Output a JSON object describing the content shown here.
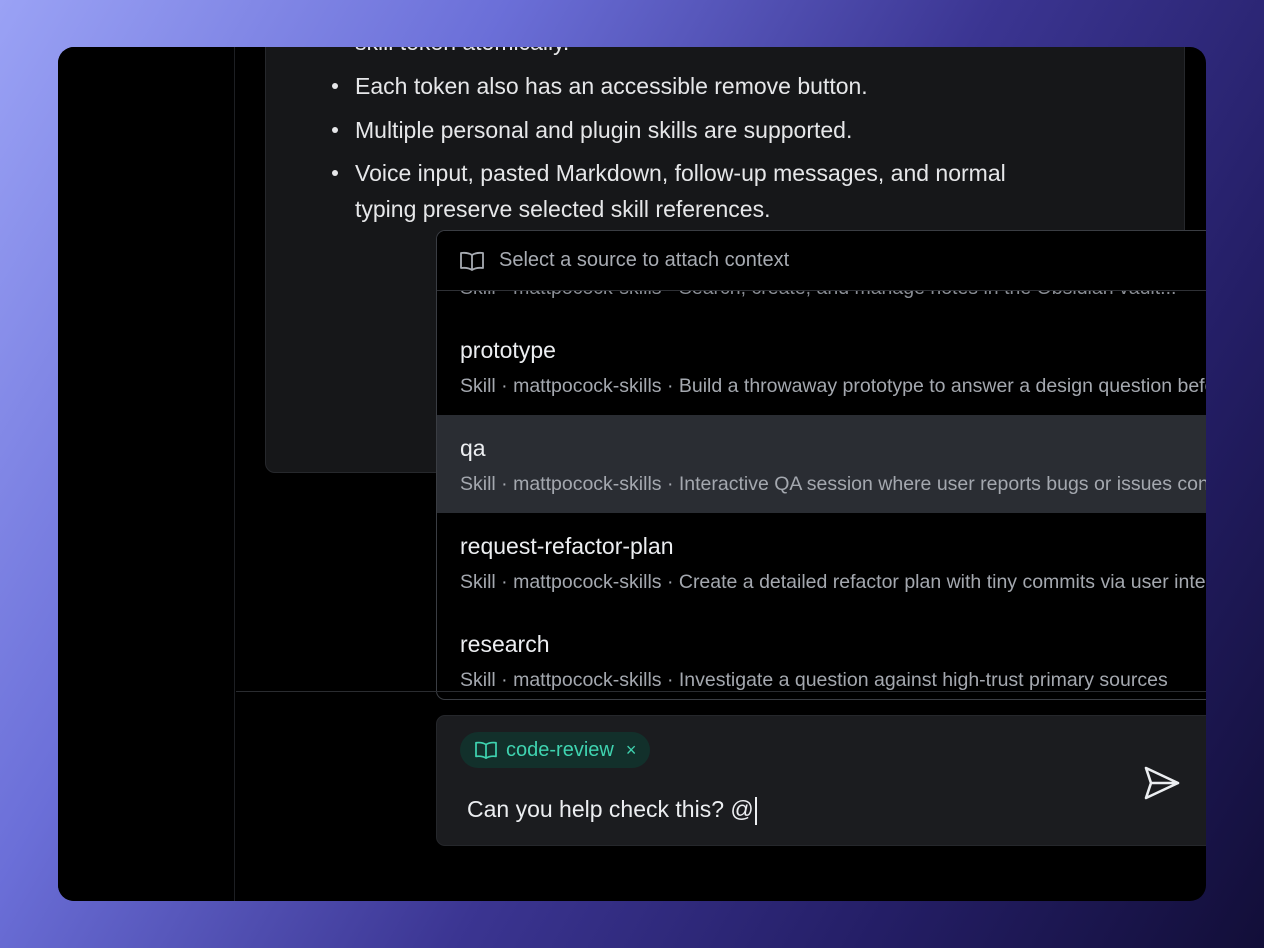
{
  "message": {
    "lines": [
      "skill token atomically.",
      "Each token also has an accessible remove button.",
      "Multiple personal and plugin skills are supported.",
      "Voice input, pasted Markdown, follow-up messages, and normal",
      "typing preserve selected skill references."
    ]
  },
  "popup": {
    "header": "Select a source to attach context",
    "header_icon": "book-open-icon",
    "cut_item_desc": "Skill · mattpocock-skills · Search, create, and manage notes in the Obsidian vault...",
    "items": [
      {
        "name": "prototype",
        "desc": "Skill · mattpocock-skills · Build a throwaway prototype to answer a design question before committing to an implementation"
      },
      {
        "name": "qa",
        "desc": "Skill · mattpocock-skills · Interactive QA session where user reports bugs or issues conversationally"
      },
      {
        "name": "request-refactor-plan",
        "desc": "Skill · mattpocock-skills · Create a detailed refactor plan with tiny commits via user interview"
      },
      {
        "name": "research",
        "desc": "Skill · mattpocock-skills · Investigate a question against high-trust primary sources"
      }
    ],
    "active_index": 1
  },
  "composer": {
    "chip_label": "code-review",
    "chip_icon": "book-open-icon",
    "chip_remove": "×",
    "input_value": "Can you help check this? @",
    "mic_icon": "microphone-icon",
    "send_icon": "send-icon"
  },
  "colors": {
    "accent": "#3fd3b0",
    "active_row": "#2a2d33",
    "card": "#161719"
  }
}
